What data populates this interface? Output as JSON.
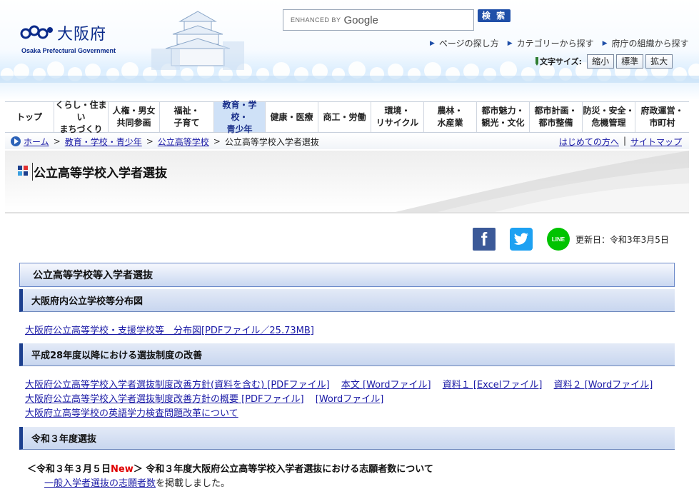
{
  "header": {
    "logo_name": "大阪府",
    "logo_en": "Osaka Prefectural Government",
    "search_label_small": "ENHANCED BY",
    "search_label_brand": "Google",
    "search_button": "検 索",
    "util_links": [
      "ページの探し方",
      "カテゴリーから探す",
      "府庁の組織から探す"
    ],
    "fontsize_label": "文字サイズ:",
    "fontsize_buttons": [
      "縮小",
      "標準",
      "拡大"
    ]
  },
  "nav": {
    "items": [
      "トップ",
      "くらし・住まい\nまちづくり",
      "人権・男女\n共同参画",
      "福祉・\n子育て",
      "教育・学校・\n青少年",
      "健康・医療",
      "商工・労働",
      "環境・\nリサイクル",
      "農林・\n水産業",
      "都市魅力・\n観光・文化",
      "都市計画・\n都市整備",
      "防災・安全・\n危機管理",
      "府政運営・\n市町村"
    ],
    "active_index": 4
  },
  "breadcrumb": {
    "home": "ホーム",
    "level1": "教育・学校・青少年",
    "level2": "公立高等学校",
    "current": "公立高等学校入学者選抜",
    "sep": ">",
    "right_links": [
      "はじめての方へ",
      "サイトマップ"
    ],
    "right_sep": "|"
  },
  "page": {
    "title": "公立高等学校入学者選抜",
    "updated": "更新日：令和3年3月5日"
  },
  "content": {
    "h2": "公立高等学校等入学者選抜",
    "sections": [
      {
        "heading": "大阪府内公立学校等分布図",
        "lines": [
          [
            "大阪府公立高等学校・支援学校等　分布図[PDFファイル／25.73MB]"
          ]
        ]
      },
      {
        "heading": "平成28年度以降における選抜制度の改善",
        "lines": [
          [
            "大阪府公立高等学校入学者選抜制度改善方針(資料を含む) [PDFファイル]",
            "本文 [Wordファイル]",
            "資料１ [Excelファイル]",
            "資料２ [Wordファイル]"
          ],
          [
            "大阪府公立高等学校入学者選抜制度改善方針の概要 [PDFファイル]",
            "[Wordファイル]"
          ],
          [
            "大阪府立高等学校の英語学力検査問題改革について"
          ]
        ]
      },
      {
        "heading": "令和３年度選抜"
      }
    ],
    "news": {
      "date_prefix": "＜令和３年３月５日",
      "new_badge": "New",
      "title": "＞ 令和３年度大阪府公立高等学校入学者選抜における志願者数について",
      "link": "一般入学者選抜の志願者数",
      "suffix": "を掲載しました。"
    }
  },
  "colors": {
    "accent_blue": "#1c3f8e",
    "nav_active_bg": "#cfe1f7",
    "new_badge": "#e00000",
    "facebook": "#3b5998",
    "twitter": "#1da1f2",
    "line": "#00c300"
  },
  "icons": {
    "social": [
      "facebook-icon",
      "twitter-icon",
      "line-icon"
    ],
    "title": "title-square-icon",
    "home": "home-arrow-icon"
  }
}
